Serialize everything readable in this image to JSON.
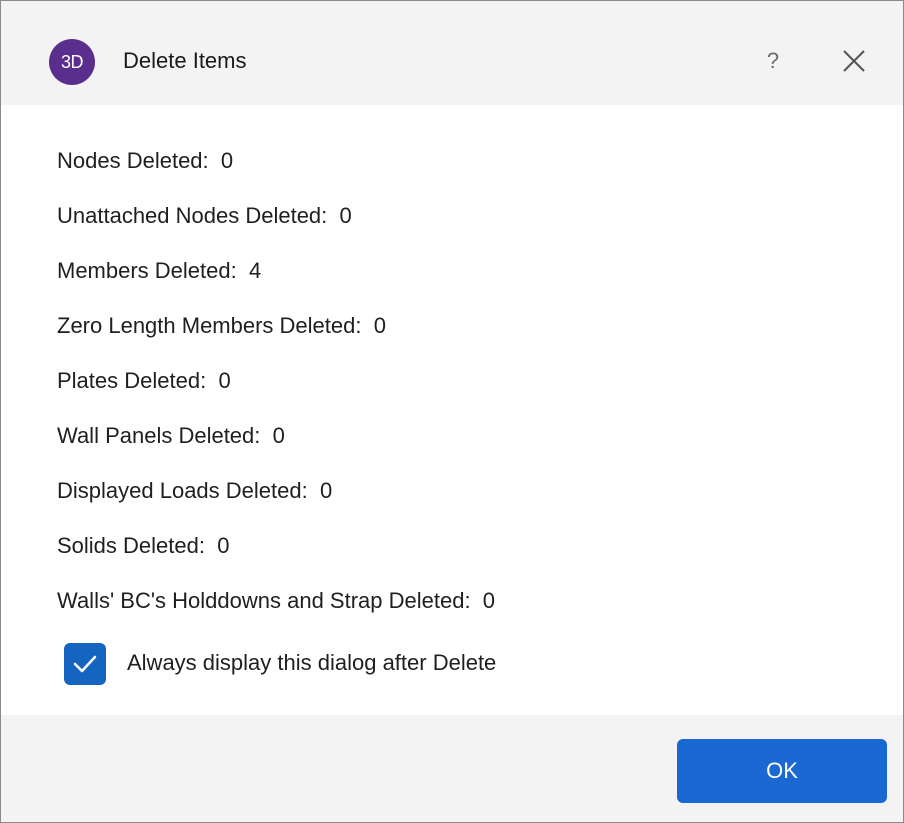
{
  "dialog": {
    "app_icon_text": "3D",
    "title": "Delete Items",
    "help_label": "?",
    "close_icon": "close-icon"
  },
  "stats": [
    {
      "label": "Nodes Deleted:",
      "value": "0"
    },
    {
      "label": "Unattached Nodes Deleted:",
      "value": "0"
    },
    {
      "label": "Members Deleted:",
      "value": "4"
    },
    {
      "label": "Zero Length Members Deleted:",
      "value": "0"
    },
    {
      "label": "Plates Deleted:",
      "value": "0"
    },
    {
      "label": "Wall Panels Deleted:",
      "value": "0"
    },
    {
      "label": "Displayed Loads Deleted:",
      "value": "0"
    },
    {
      "label": "Solids Deleted:",
      "value": "0"
    },
    {
      "label": "Walls' BC's Holddowns and Strap Deleted:",
      "value": "0"
    }
  ],
  "option": {
    "checked": true,
    "label": "Always display this dialog after Delete"
  },
  "buttons": {
    "ok_label": "OK"
  },
  "colors": {
    "accent": "#1a68d1",
    "app_icon_bg": "#5a2e8c",
    "chrome_bg": "#f3f3f3"
  }
}
